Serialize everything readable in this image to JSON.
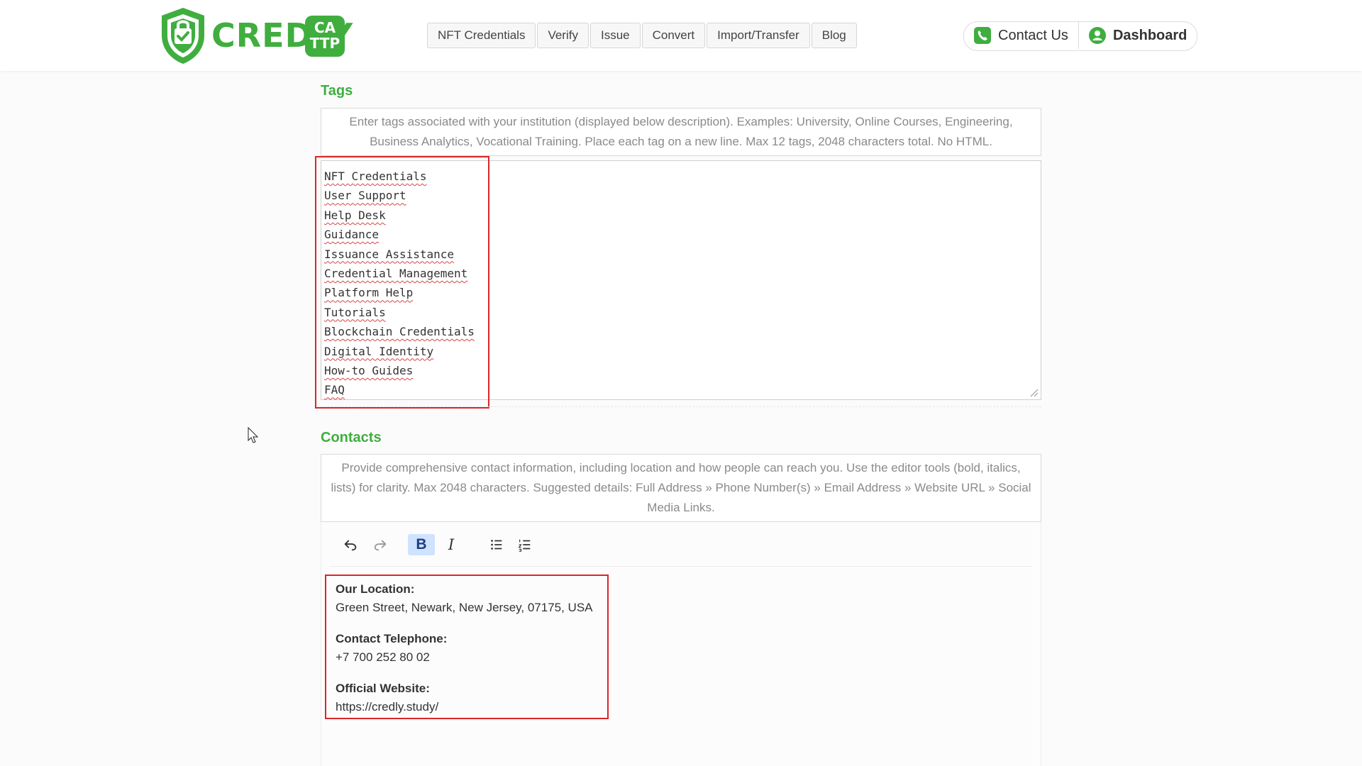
{
  "header": {
    "logo": {
      "word": "CREDLY",
      "badge_line1": "CA",
      "badge_line2": "TTP"
    },
    "nav": [
      "NFT Credentials",
      "Verify",
      "Issue",
      "Convert",
      "Import/Transfer",
      "Blog"
    ],
    "contact_label": "Contact Us",
    "dashboard_label": "Dashboard",
    "contact_icon": "phone-icon",
    "dashboard_icon": "user-icon"
  },
  "tags": {
    "title": "Tags",
    "hint": "Enter tags associated with your institution (displayed below description). Examples: University, Online Courses, Engineering, Business Analytics, Vocational Training. Place each tag on a new line. Max 12 tags, 2048 characters total. No HTML.",
    "items": [
      "NFT Credentials",
      "User Support",
      "Help Desk",
      "Guidance",
      "Issuance Assistance",
      "Credential Management",
      "Platform Help",
      "Tutorials",
      "Blockchain Credentials",
      "Digital Identity",
      "How-to Guides",
      "FAQ"
    ]
  },
  "contacts": {
    "title": "Contacts",
    "hint": "Provide comprehensive contact information, including location and how people can reach you. Use the editor tools (bold, italics, lists) for clarity. Max 2048 characters. Suggested details: Full Address » Phone Number(s) » Email Address » Website URL » Social Media Links.",
    "toolbar": {
      "undo_icon": "undo-icon",
      "redo_icon": "redo-icon",
      "bold": "B",
      "italic": "I",
      "bullet_icon": "bullet-list-icon",
      "numbered_icon": "numbered-list-icon",
      "bold_active": true
    },
    "entries": [
      {
        "label": "Our Location:",
        "value": "Green Street, Newark, New Jersey, 07175, USA"
      },
      {
        "label": "Contact Telephone:",
        "value": "+7 700 252 80 02"
      },
      {
        "label": "Official Website:",
        "value": "https://credly.study/"
      }
    ]
  },
  "colors": {
    "brand_green": "#3fae3f",
    "highlight_red": "#d9262a",
    "active_button": "#cfe3ff"
  }
}
